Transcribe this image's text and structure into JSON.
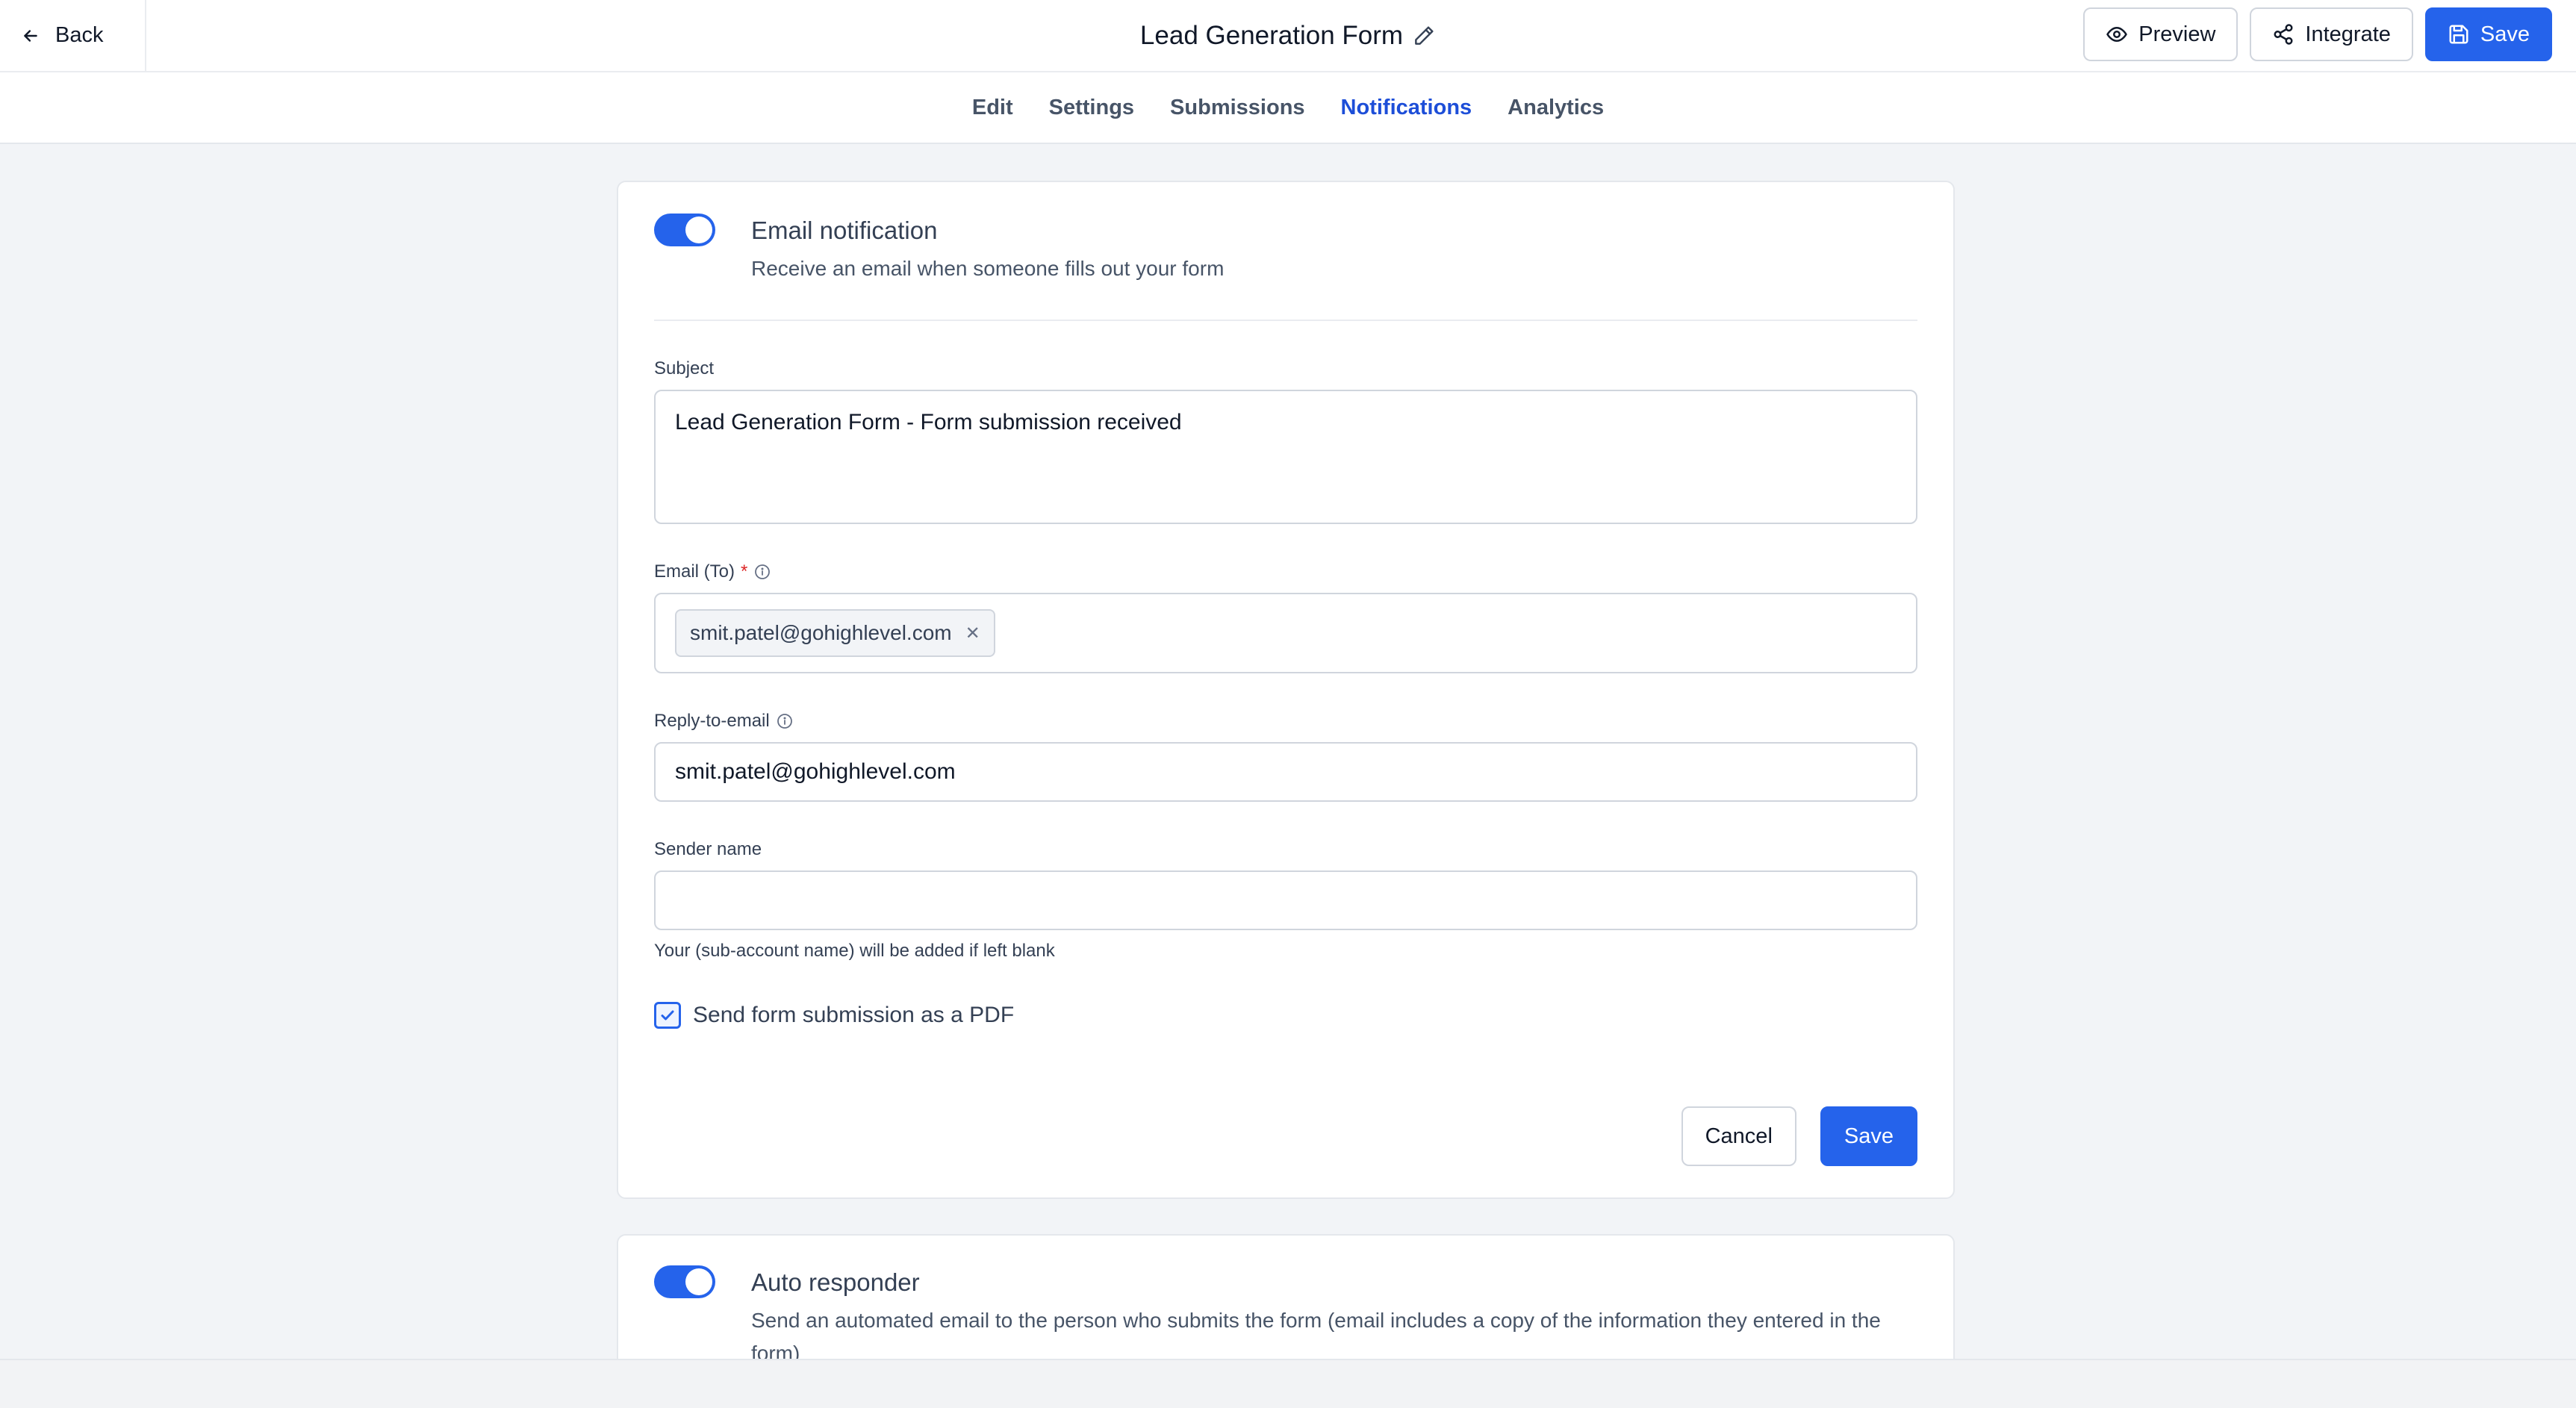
{
  "header": {
    "back_label": "Back",
    "title": "Lead Generation Form",
    "actions": {
      "preview": "Preview",
      "integrate": "Integrate",
      "save": "Save"
    }
  },
  "tabs": [
    {
      "label": "Edit",
      "active": false
    },
    {
      "label": "Settings",
      "active": false
    },
    {
      "label": "Submissions",
      "active": false
    },
    {
      "label": "Notifications",
      "active": true
    },
    {
      "label": "Analytics",
      "active": false
    }
  ],
  "email_notification": {
    "enabled": true,
    "title": "Email notification",
    "description": "Receive an email when someone fills out your form",
    "subject": {
      "label": "Subject",
      "value": "Lead Generation Form - Form submission received"
    },
    "email_to": {
      "label": "Email (To)",
      "required_mark": "*",
      "chips": [
        "smit.patel@gohighlevel.com"
      ]
    },
    "reply_to": {
      "label": "Reply-to-email",
      "value": "smit.patel@gohighlevel.com"
    },
    "sender_name": {
      "label": "Sender name",
      "value": "",
      "hint": "Your (sub-account name) will be added if left blank"
    },
    "send_pdf": {
      "checked": true,
      "label": "Send form submission as a PDF"
    },
    "cancel_label": "Cancel",
    "save_label": "Save"
  },
  "auto_responder": {
    "enabled": true,
    "title": "Auto responder",
    "description": "Send an automated email to the person who submits the form (email includes a copy of the information they entered in the form)"
  },
  "colors": {
    "primary": "#2563eb",
    "active_tab": "#1d4ed8",
    "required": "#dc2626",
    "background": "#f2f4f7"
  }
}
